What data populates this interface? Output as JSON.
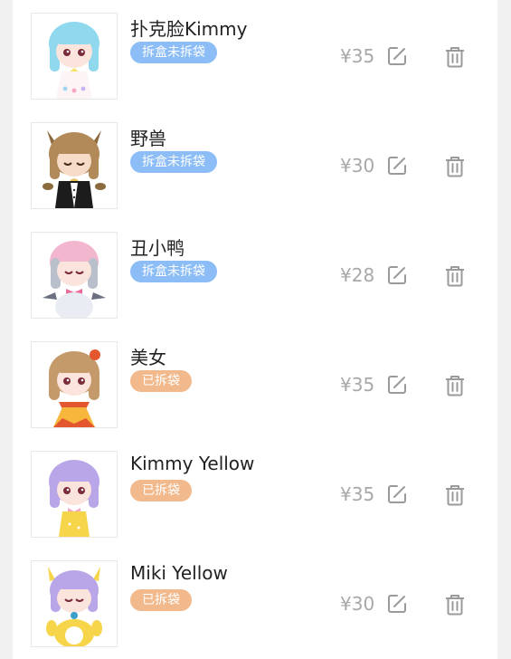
{
  "colors": {
    "badge_unopened": "#8cbdf6",
    "badge_opened": "#f1b98c",
    "price_text": "#a8a8a8",
    "icon": "#9a9a9a"
  },
  "items": [
    {
      "name": "扑克脸Kimmy",
      "status": "拆盒未拆袋",
      "price": "¥35",
      "thumbnail_icon": "figure-kimmy-pokerface-icon"
    },
    {
      "name": "野兽",
      "status": "拆盒未拆袋",
      "price": "¥30",
      "thumbnail_icon": "figure-beast-icon"
    },
    {
      "name": "丑小鸭",
      "status": "拆盒未拆袋",
      "price": "¥28",
      "thumbnail_icon": "figure-ugly-duckling-icon"
    },
    {
      "name": "美女",
      "status": "已拆袋",
      "price": "¥35",
      "thumbnail_icon": "figure-beauty-icon"
    },
    {
      "name": "Kimmy Yellow",
      "status": "已拆袋",
      "price": "¥35",
      "thumbnail_icon": "figure-kimmy-yellow-icon"
    },
    {
      "name": "Miki Yellow",
      "status": "已拆袋",
      "price": "¥30",
      "thumbnail_icon": "figure-miki-yellow-icon"
    }
  ]
}
